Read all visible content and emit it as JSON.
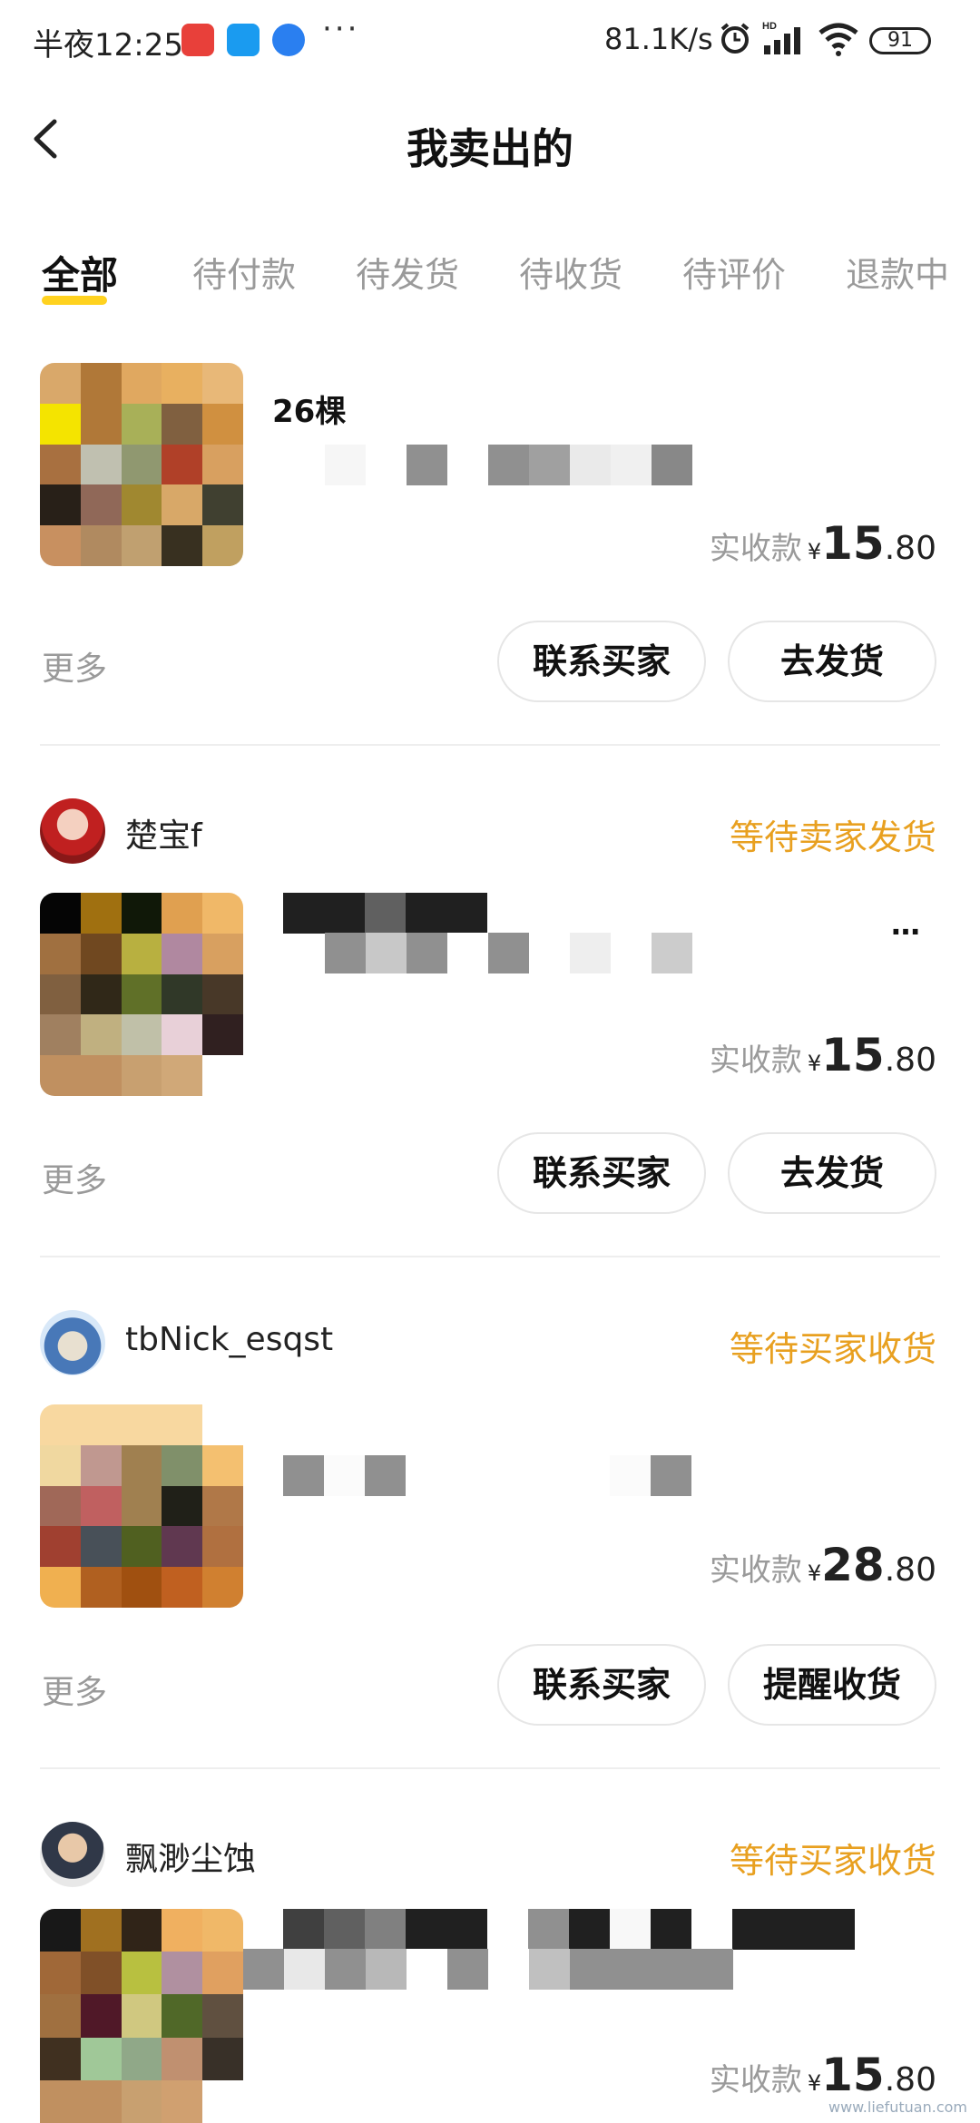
{
  "status_bar": {
    "time": "半夜12:25",
    "dots": "···",
    "speed": "81.1K/s",
    "battery": "91"
  },
  "header": {
    "title": "我卖出的"
  },
  "tabs": [
    {
      "label": "全部",
      "active": true
    },
    {
      "label": "待付款"
    },
    {
      "label": "待发货"
    },
    {
      "label": "待收货"
    },
    {
      "label": "待评价"
    },
    {
      "label": "退款中"
    }
  ],
  "orders": [
    {
      "title_fragment": "26棵",
      "price_label": "实收款",
      "currency": "¥",
      "price_int": "15",
      "price_dec": ".80",
      "more": "更多",
      "buttons": [
        "联系买家",
        "去发货"
      ]
    },
    {
      "username": "楚宝f",
      "status": "等待卖家发货",
      "title_fragment": "…",
      "price_label": "实收款",
      "currency": "¥",
      "price_int": "15",
      "price_dec": ".80",
      "more": "更多",
      "buttons": [
        "联系买家",
        "去发货"
      ]
    },
    {
      "username": "tbNick_esqst",
      "status": "等待买家收货",
      "price_label": "实收款",
      "currency": "¥",
      "price_int": "28",
      "price_dec": ".80",
      "more": "更多",
      "buttons": [
        "联系买家",
        "提醒收货"
      ]
    },
    {
      "username": "飘渺尘蚀",
      "status": "等待买家收货",
      "price_label": "实收款",
      "currency": "¥",
      "price_int": "15",
      "price_dec": ".80"
    }
  ],
  "watermark": "www.liefutuan.com",
  "colors": {
    "accent_yellow": "#ffd21f",
    "status_orange": "#e8a020"
  }
}
